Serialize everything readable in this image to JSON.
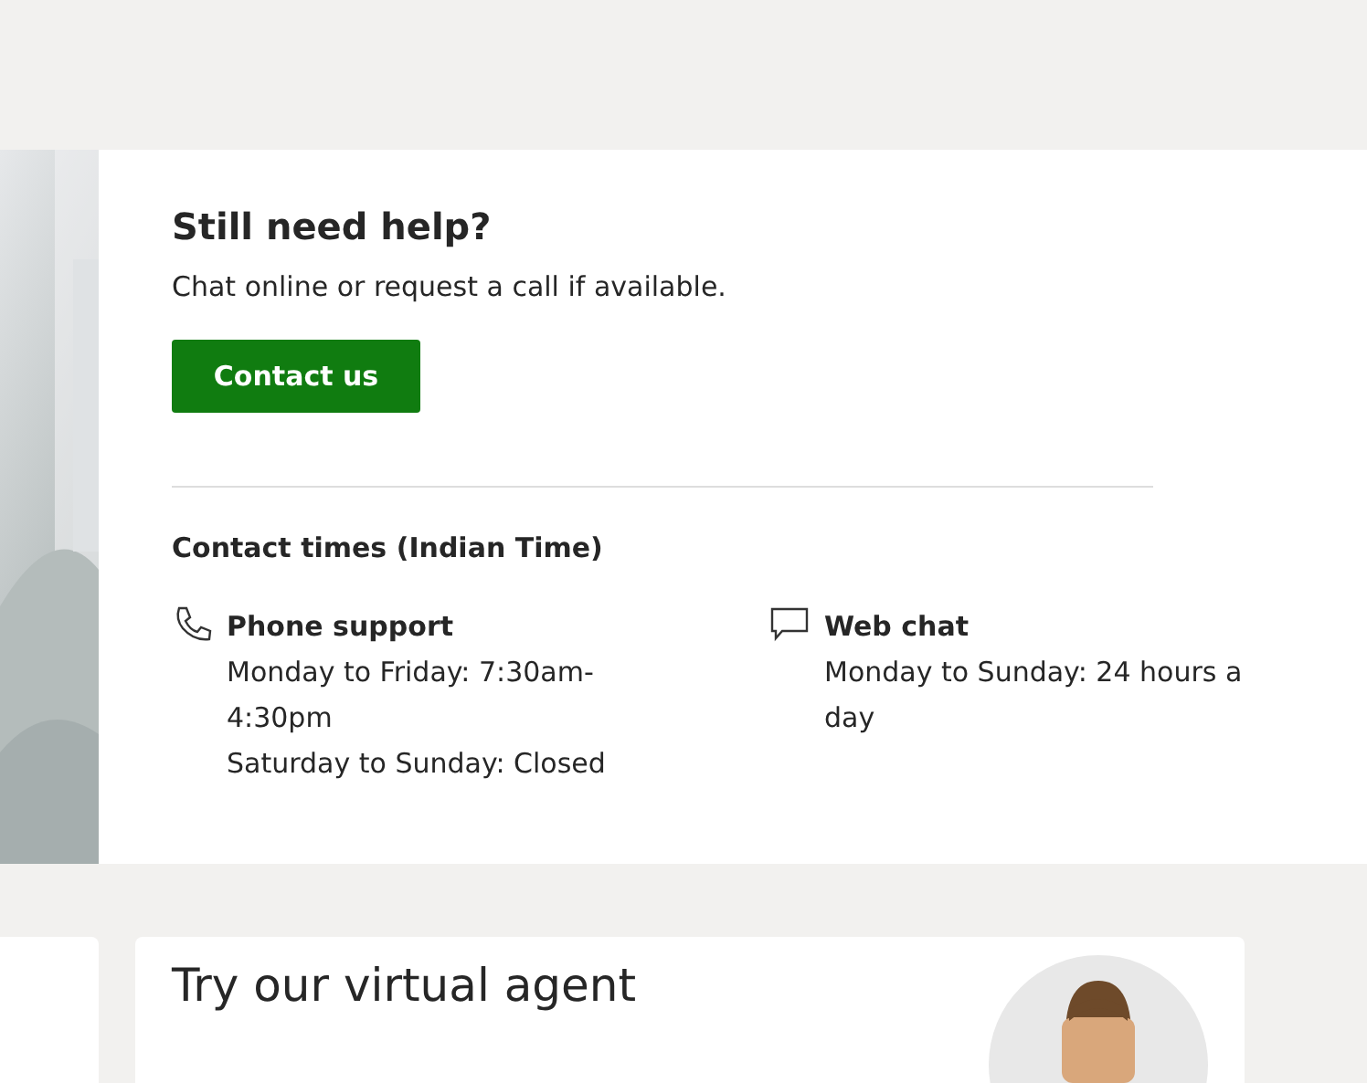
{
  "help": {
    "title": "Still need help?",
    "subtitle": "Chat online or request a call if available.",
    "button": "Contact us",
    "times_heading": "Contact times (Indian Time)",
    "channels": [
      {
        "kind": "phone",
        "name": "Phone support",
        "lines": [
          "Monday to Friday: 7:30am-4:30pm",
          "Saturday to Sunday: Closed"
        ]
      },
      {
        "kind": "chat",
        "name": "Web chat",
        "lines": [
          "Monday to Sunday: 24 hours a day"
        ]
      }
    ]
  },
  "agent_card": {
    "title": "Try our virtual agent"
  }
}
